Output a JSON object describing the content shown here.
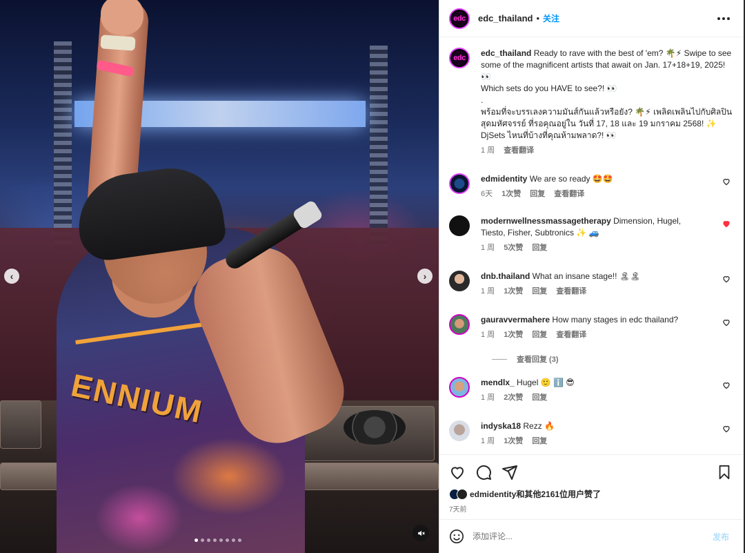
{
  "media": {
    "jersey_text": "ENNIUM",
    "carousel_dots": 8,
    "active_dot": 0,
    "prev_glyph": "‹",
    "next_glyph": "›",
    "mute_icon": "speaker-muted-icon"
  },
  "header": {
    "username": "edc_thailand",
    "separator": "•",
    "follow_label": "关注",
    "avatar_logo": "edc"
  },
  "caption": {
    "username": "edc_thailand",
    "body": "Ready to rave with the best of 'em? 🌴⚡ Swipe to see some of the magnificent artists that await on Jan. 17+18+19, 2025! 👀\nWhich sets do you HAVE to see?! 👀\n.\nพร้อมที่จะบรรเลงความมันส์กันแล้วหรือยัง? 🌴⚡ เพลิดเพลินไปกับศิลปินสุดมหัศจรรย์ ที่รอคุณอยู่ใน วันที่ 17, 18 และ 19 มกราคม 2568! ✨\nDjSets ไหนที่บ้างที่คุณห้ามพลาด?! 👀",
    "time": "1 周",
    "translate": "查看翻译"
  },
  "comments": [
    {
      "username": "edmidentity",
      "text": "We are so ready 🤩🤩",
      "time": "6天",
      "likes": "1次赞",
      "reply": "回复",
      "translate": "查看翻译",
      "liked": false
    },
    {
      "username": "modernwellnessmassagetherapy",
      "text": "Dimension, Hugel, Tiesto, Fisher, Subtronics ✨ 🚙",
      "time": "1 周",
      "likes": "5次赞",
      "reply": "回复",
      "translate": "",
      "liked": true
    },
    {
      "username": "dnb.thailand",
      "text": "What an insane stage!! 🏝🏝",
      "time": "1 周",
      "likes": "1次赞",
      "reply": "回复",
      "translate": "查看翻译",
      "liked": false
    },
    {
      "username": "gauravvermahere",
      "text": "How many stages in edc thailand?",
      "time": "1 周",
      "likes": "1次赞",
      "reply": "回复",
      "translate": "查看翻译",
      "liked": false
    },
    {
      "username": "mendlx_",
      "text": "Hugel 🙂 ℹ️ 😎",
      "time": "1 周",
      "likes": "2次赞",
      "reply": "回复",
      "translate": "",
      "liked": false
    },
    {
      "username": "indyska18",
      "text": "Rezz 🔥",
      "time": "1 周",
      "likes": "1次赞",
      "reply": "回复",
      "translate": "",
      "liked": false
    }
  ],
  "view_replies": "查看回复 (3)",
  "likes_line": "edmidentity和其他2161位用户赞了",
  "time_ago": "7天前",
  "add_comment": {
    "placeholder": "添加评论...",
    "post_label": "发布"
  },
  "colors": {
    "accent_blue": "#0095f6",
    "liked_red": "#ff3040",
    "post_disabled": "#b2dffc",
    "brand_magenta": "#ff2bd6"
  }
}
